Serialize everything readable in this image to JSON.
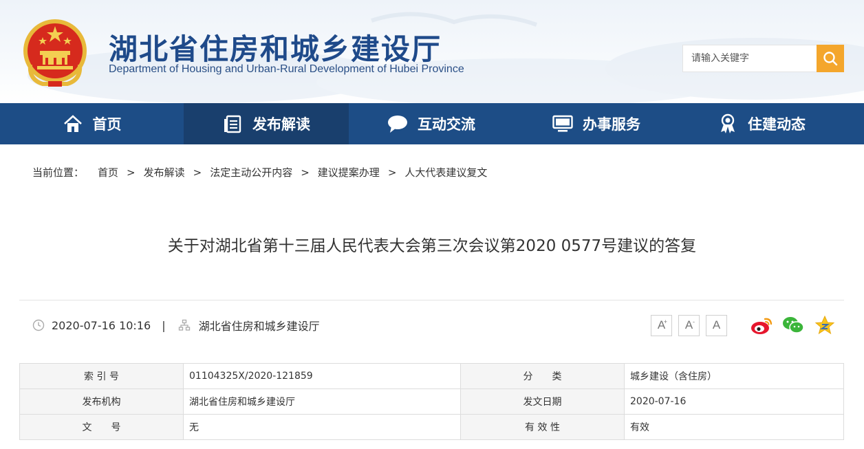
{
  "header": {
    "title": "湖北省住房和城乡建设厅",
    "subtitle": "Department of Housing and Urban-Rural Development of Hubei Province",
    "search_placeholder": "请输入关键字"
  },
  "nav": [
    {
      "label": "首页",
      "icon": "home-icon"
    },
    {
      "label": "发布解读",
      "icon": "document-list-icon",
      "active": true
    },
    {
      "label": "互动交流",
      "icon": "chat-bubble-icon"
    },
    {
      "label": "办事服务",
      "icon": "monitor-icon"
    },
    {
      "label": "住建动态",
      "icon": "award-icon"
    }
  ],
  "breadcrumb": {
    "label": "当前位置：",
    "items": [
      "首页",
      "发布解读",
      "法定主动公开内容",
      "建议提案办理",
      "人大代表建议复文"
    ],
    "separator": ">"
  },
  "article": {
    "title": "关于对湖北省第十三届人民代表大会第三次会议第2020 0577号建议的答复",
    "datetime": "2020-07-16 10:16",
    "meta_sep": "|",
    "source": "湖北省住房和城乡建设厅"
  },
  "font_tools": {
    "increase": "A",
    "decrease": "A",
    "reset": "A",
    "increase_sup": "+",
    "decrease_sup": "-"
  },
  "share": [
    "weibo-icon",
    "wechat-icon",
    "favorite-star-icon"
  ],
  "info_table": [
    {
      "k1": "索 引 号",
      "v1": "01104325X/2020-121859",
      "k2": "分　　类",
      "v2": "城乡建设（含住房）"
    },
    {
      "k1": "发布机构",
      "v1": "湖北省住房和城乡建设厅",
      "k2": "发文日期",
      "v2": "2020-07-16"
    },
    {
      "k1": "文　　号",
      "v1": "无",
      "k2": "有 效 性",
      "v2": "有效"
    }
  ],
  "colors": {
    "nav": "#1d4d86",
    "nav_active": "#193f6d",
    "title": "#1f4a8a",
    "search_button": "#f4a62c"
  }
}
